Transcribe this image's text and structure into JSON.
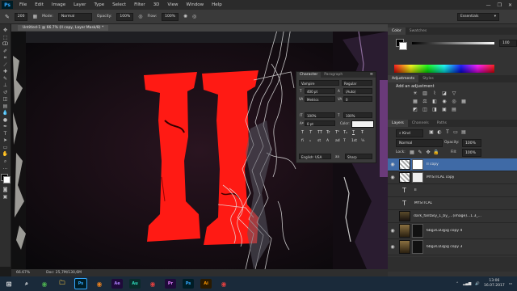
{
  "colors": {
    "red_glyph": "#ff1a14",
    "selected_layer": "#3f6aa6",
    "accent": "#31a8ff"
  },
  "app": {
    "logo": "Ps"
  },
  "menu": [
    "File",
    "Edit",
    "Image",
    "Layer",
    "Type",
    "Select",
    "Filter",
    "3D",
    "View",
    "Window",
    "Help"
  ],
  "window_controls": {
    "minimize": "—",
    "restore": "❐",
    "close": "✕"
  },
  "options": {
    "size": "200",
    "mode_label": "Mode:",
    "mode_value": "Normal",
    "opacity_label": "Opacity:",
    "opacity_value": "100%",
    "flow_label": "Flow:",
    "flow_value": "100%",
    "workspace": "Essentials"
  },
  "document": {
    "tab_title": "Untitled-1 @ 66.7% (II copy, Layer Mask/8) *",
    "zoom": "66.67%",
    "doc_size": "Doc: 25,7M/130,6M"
  },
  "canvas": {
    "glyph": "II"
  },
  "character": {
    "tabs": [
      "Character",
      "Paragraph"
    ],
    "font_family": "Vampire",
    "font_style": "Regular",
    "size": "400 pt",
    "leading": "(Auto)",
    "kerning": "Metrics",
    "tracking": "0",
    "vscale": "100%",
    "hscale": "100%",
    "baseline": "0 pt",
    "color_label": "Color:",
    "type_buttons": [
      "T",
      "T",
      "TT",
      "Tr",
      "T¹",
      "T₁",
      "T",
      "Ŧ"
    ],
    "opentype_buttons": [
      "fi",
      "ℴ",
      "st",
      "A",
      "ad",
      "T",
      "1st",
      "½"
    ],
    "language": "English: USA",
    "aa_label": "aa",
    "antialias": "Sharp"
  },
  "panels": {
    "color_tabs": [
      "Color",
      "Swatches"
    ],
    "adjust_tabs": [
      "Adjustments",
      "Styles"
    ],
    "adjust_title": "Add an adjustment",
    "layer_tabs": [
      "Layers",
      "Channels",
      "Paths"
    ],
    "kind": "Kind",
    "blend": "Normal",
    "opacity_label": "Opacity:",
    "opacity_value": "100%",
    "lock_label": "Lock:",
    "fill_label": "Fill:",
    "fill_value": "100%",
    "slider_value": "100"
  },
  "layers": [
    {
      "name": "II copy",
      "type": "image",
      "selected": true
    },
    {
      "name": "MYSTICAL copy",
      "type": "image",
      "selected": false
    },
    {
      "name": "II",
      "type": "text",
      "selected": false
    },
    {
      "name": "MYSTICAL",
      "type": "text",
      "selected": false
    },
    {
      "name": "dark_fantasy_1_by_...(image)...1.3_...",
      "type": "photo",
      "selected": false
    },
    {
      "name": "6bg3CD3jpg copy 4",
      "type": "photo",
      "selected": false
    },
    {
      "name": "6bg3CD3jpg copy 3",
      "type": "photo",
      "selected": false
    }
  ],
  "taskbar": {
    "icons": [
      "⊞",
      "⌕",
      "◉",
      "🗀",
      "Ps",
      "◉",
      "Ae",
      "Au",
      "◉",
      "Pr",
      "Ps",
      "Ai",
      "◉"
    ],
    "time": "13:06",
    "date": "16.07.2017"
  }
}
